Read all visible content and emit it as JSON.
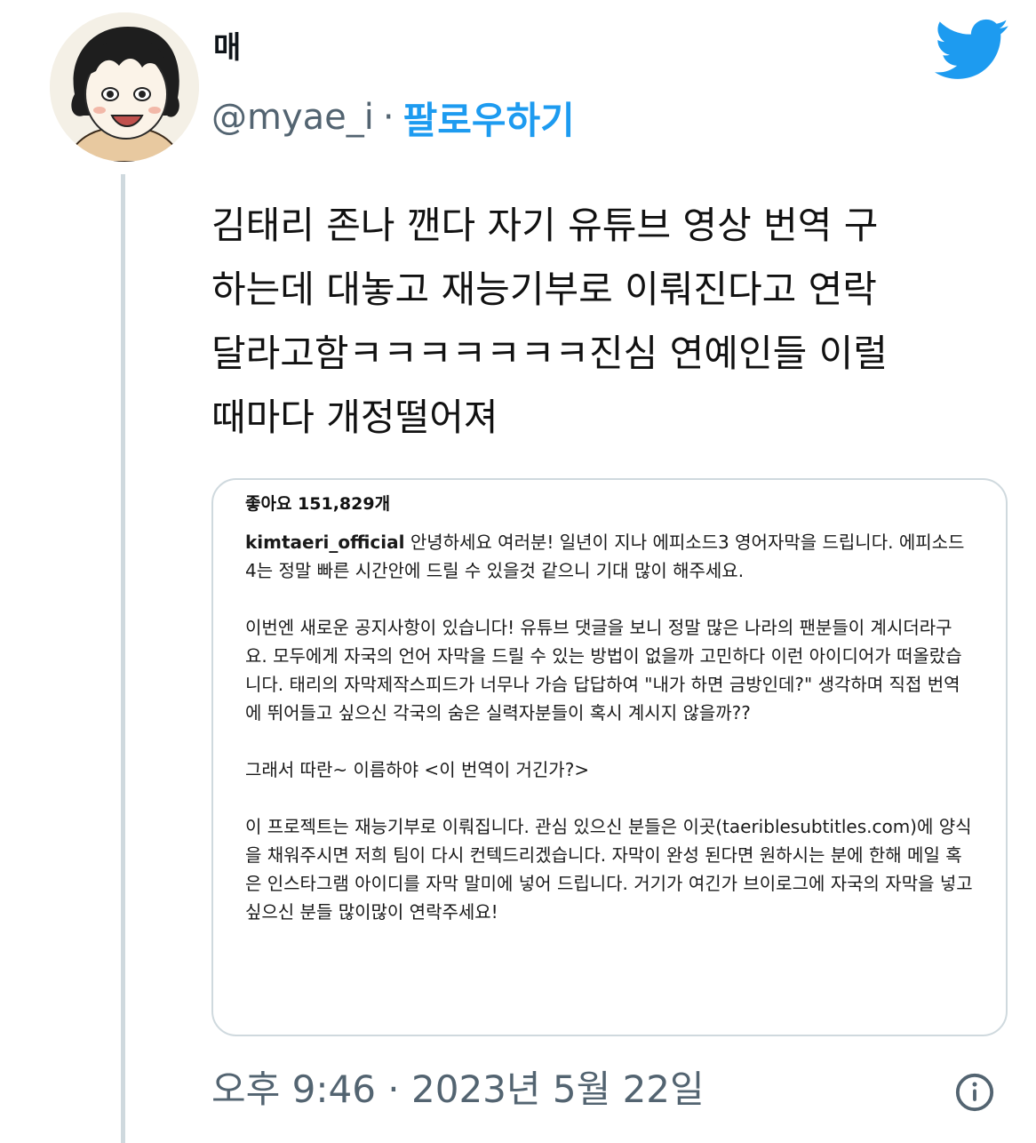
{
  "tweet": {
    "author_name": "매",
    "handle": "@myae_i",
    "separator": "·",
    "follow_label": "팔로우하기",
    "text_lines": [
      "김태리 존나 깬다 자기 유튜브 영상 번역 구",
      "하는데 대놓고 재능기부로 이뤄진다고 연락",
      "달라고함ㅋㅋㅋㅋㅋㅋㅋ진심 연예인들 이럴",
      "때마다 개정떨어져"
    ],
    "timestamp": "오후 9:46 · 2023년 5월 22일"
  },
  "embedded_post": {
    "likes": "좋아요 151,829개",
    "username": "kimtaeri_official",
    "caption_first": "안녕하세요 여러분! 일년이 지나 에피소드3 영어자막을 드립니다. 에피소드4는 정말 빠른 시간안에 드릴 수 있을것 같으니 기대 많이 해주세요.",
    "paragraphs": [
      "이번엔 새로운 공지사항이 있습니다! 유튜브 댓글을 보니 정말 많은 나라의 팬분들이 계시더라구요. 모두에게 자국의 언어 자막을 드릴 수 있는 방법이 없을까 고민하다 이런 아이디어가 떠올랐습니다. 태리의 자막제작스피드가 너무나 가슴 답답하여 \"내가 하면 금방인데?\" 생각하며 직접 번역에 뛰어들고 싶으신 각국의 숨은 실력자분들이 혹시 계시지 않을까??",
      "그래서 따란~ 이름하야 <이 번역이 거긴가?>",
      "이 프로젝트는 재능기부로 이뤄집니다. 관심 있으신 분들은 이곳(taeriblesubtitles.com)에 양식을 채워주시면 저희 팀이 다시 컨텍드리겠습니다. 자막이 완성 된다면 원하시는 분에 한해 메일 혹은 인스타그램 아이디를 자막 말미에 넣어 드립니다. 거기가 여긴가 브이로그에 자국의 자막을 넣고 싶으신 분들 많이많이 연락주세요!"
    ]
  },
  "icons": {
    "brand": "twitter-bird-icon",
    "info": "info-icon",
    "brand_color": "#1d9bf0"
  }
}
